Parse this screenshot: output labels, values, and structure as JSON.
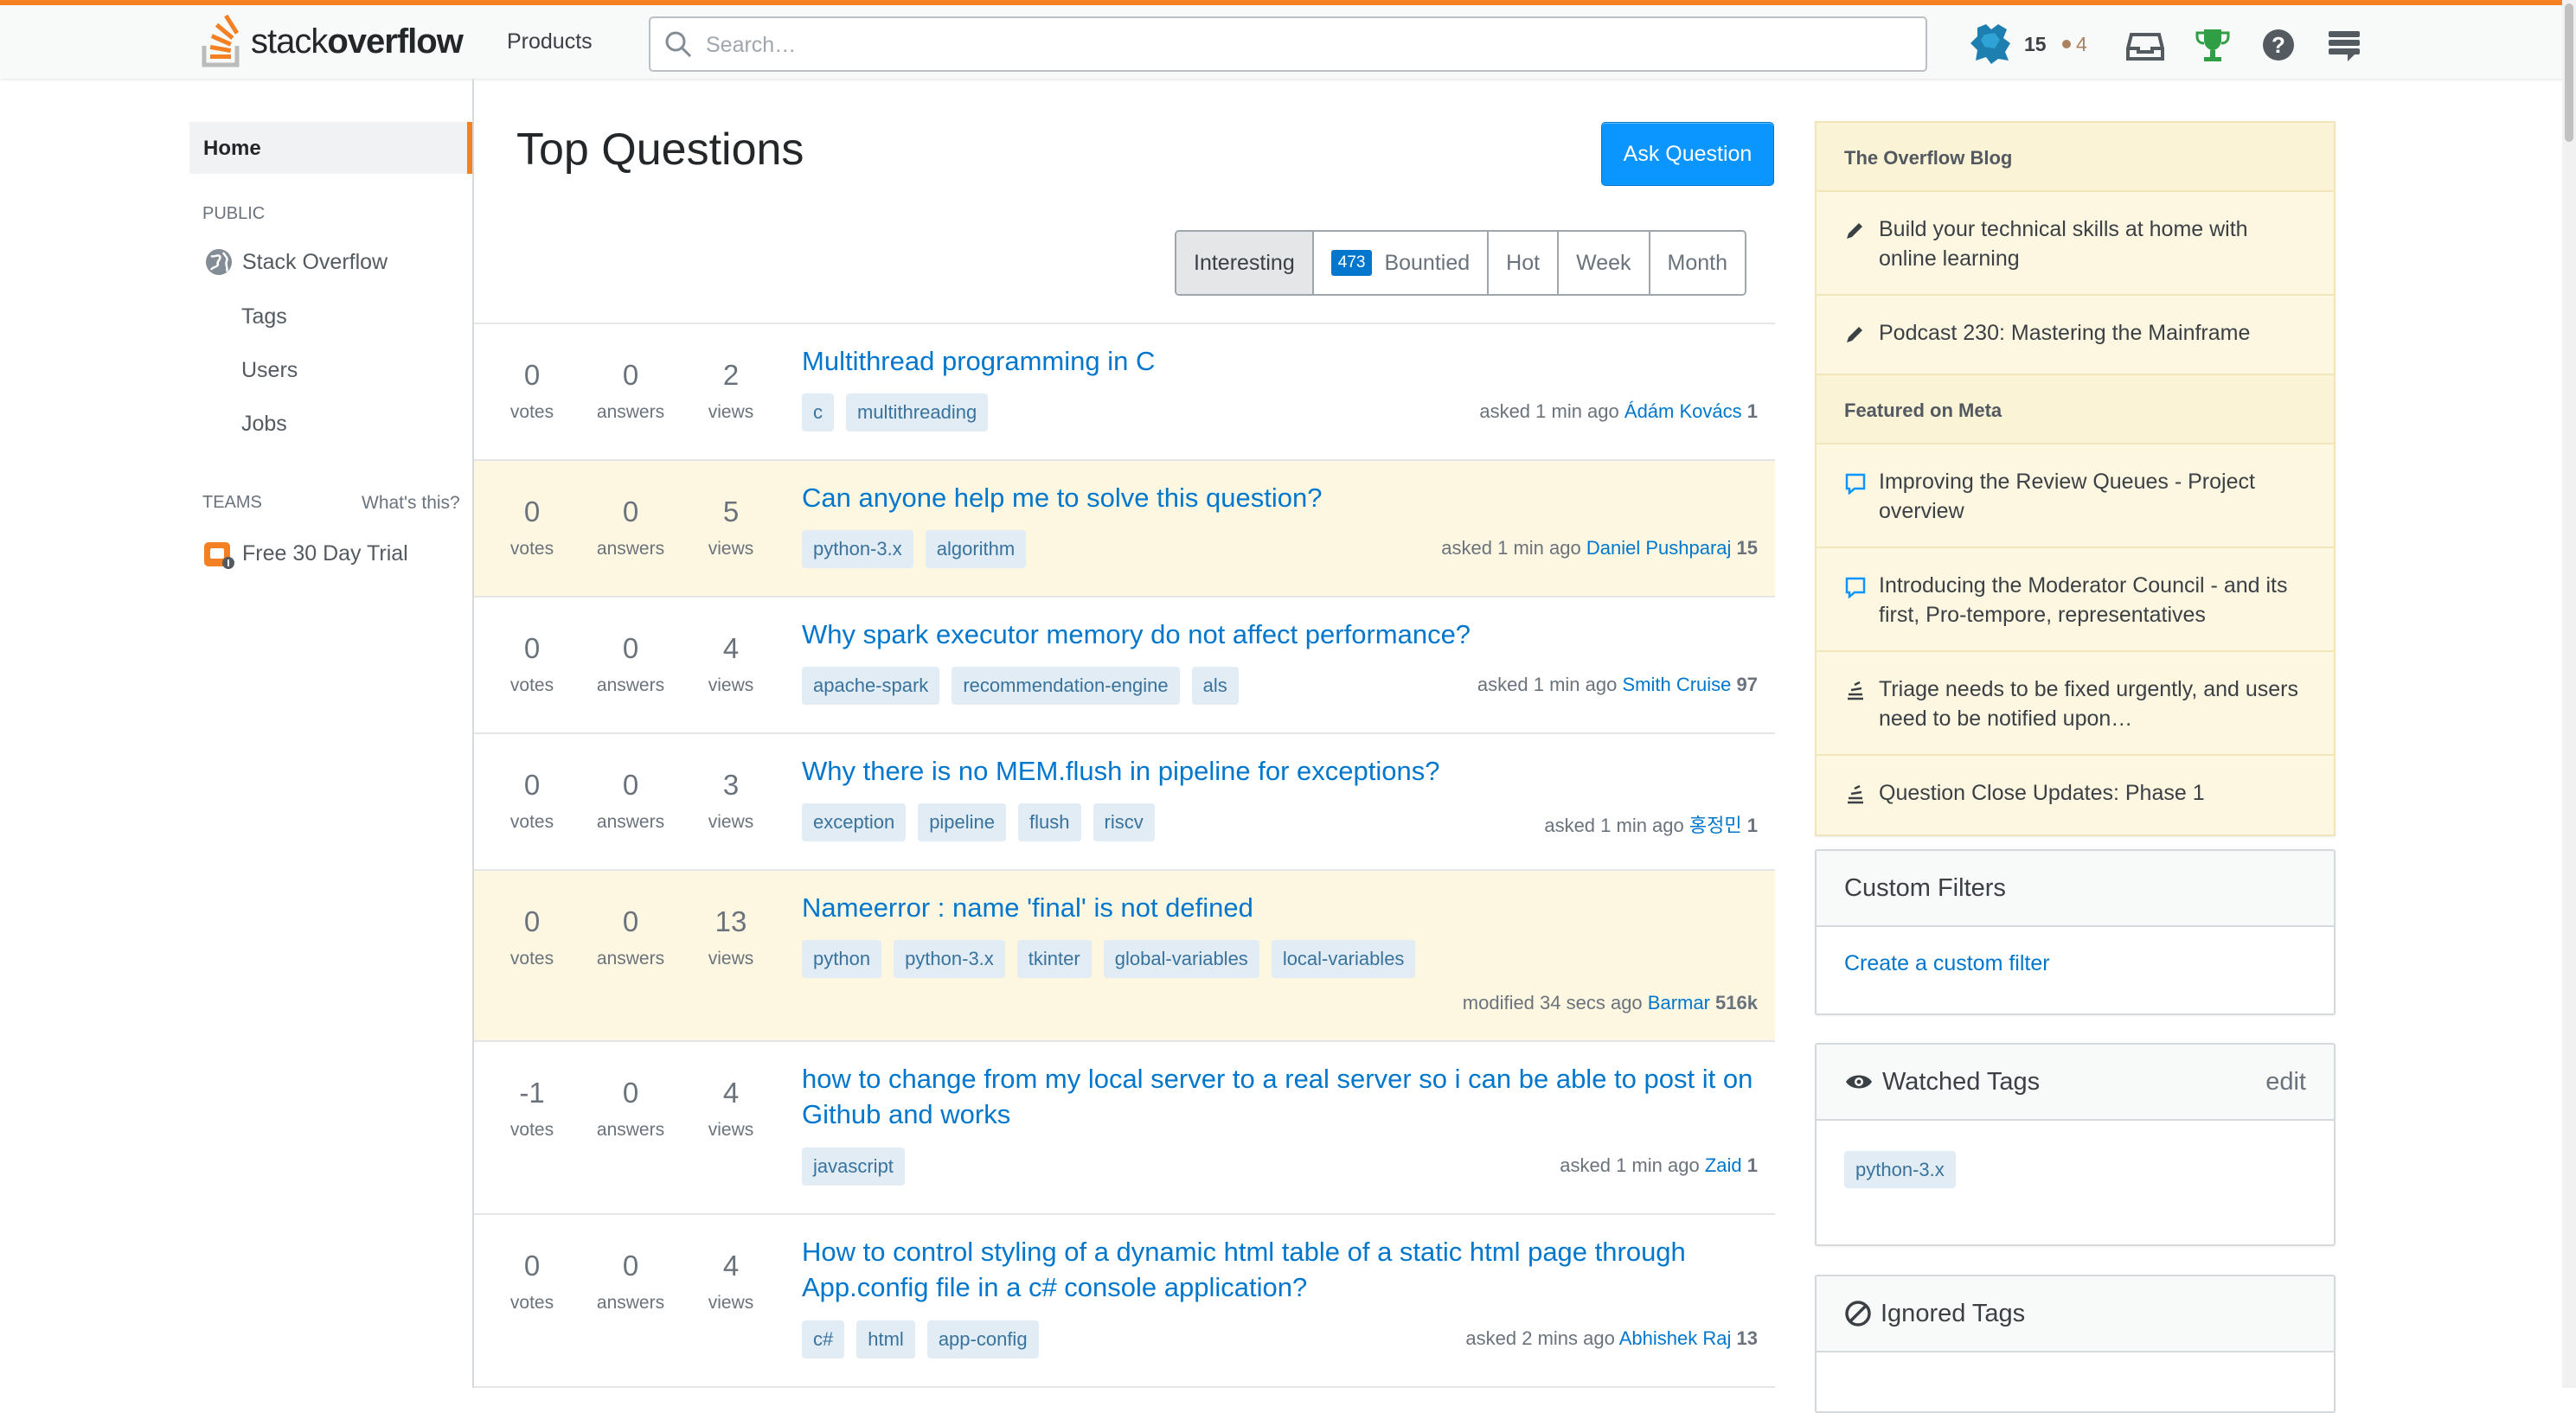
{
  "topbar": {
    "logo_text_light": "stack",
    "logo_text_bold": "overflow",
    "products_label": "Products",
    "search_placeholder": "Search…",
    "reputation": "15",
    "bronze_badges": "4",
    "icons": [
      "inbox-icon",
      "achievements-icon",
      "help-icon",
      "site-switcher-icon"
    ]
  },
  "sidebar": {
    "home_label": "Home",
    "public_heading": "PUBLIC",
    "stackoverflow_label": "Stack Overflow",
    "items": [
      "Tags",
      "Users",
      "Jobs"
    ],
    "teams_heading": "TEAMS",
    "whats_this": "What's this?",
    "trial_label": "Free 30 Day Trial"
  },
  "main": {
    "title": "Top Questions",
    "ask_button": "Ask Question",
    "filters": {
      "interesting": "Interesting",
      "bounty_count": "473",
      "bountied": "Bountied",
      "hot": "Hot",
      "week": "Week",
      "month": "Month"
    },
    "stat_labels": {
      "votes": "votes",
      "answers": "answers",
      "views": "views"
    },
    "questions": [
      {
        "votes": "0",
        "answers": "0",
        "views": "2",
        "title": "Multithread programming in C",
        "tags": [
          "c",
          "multithreading"
        ],
        "action": "asked 1 min ago",
        "user": "Ádám Kovács",
        "rep": "1"
      },
      {
        "votes": "0",
        "answers": "0",
        "views": "5",
        "title": "Can anyone help me to solve this question?",
        "tags": [
          "python-3.x",
          "algorithm"
        ],
        "action": "asked 1 min ago",
        "user": "Daniel Pushparaj",
        "rep": "15"
      },
      {
        "votes": "0",
        "answers": "0",
        "views": "4",
        "title": "Why spark executor memory do not affect performance?",
        "tags": [
          "apache-spark",
          "recommendation-engine",
          "als"
        ],
        "action": "asked 1 min ago",
        "user": "Smith Cruise",
        "rep": "97"
      },
      {
        "votes": "0",
        "answers": "0",
        "views": "3",
        "title": "Why there is no MEM.flush in pipeline for exceptions?",
        "tags": [
          "exception",
          "pipeline",
          "flush",
          "riscv"
        ],
        "action": "asked 1 min ago",
        "user": "홍정민",
        "rep": "1"
      },
      {
        "votes": "0",
        "answers": "0",
        "views": "13",
        "title": "Nameerror : name 'final' is not defined",
        "tags": [
          "python",
          "python-3.x",
          "tkinter",
          "global-variables",
          "local-variables"
        ],
        "action": "modified 34 secs ago",
        "user": "Barmar",
        "rep": "516k"
      },
      {
        "votes": "-1",
        "answers": "0",
        "views": "4",
        "title": "how to change from my local server to a real server so i can be able to post it on Github and works",
        "tags": [
          "javascript"
        ],
        "action": "asked 1 min ago",
        "user": "Zaid",
        "rep": "1"
      },
      {
        "votes": "0",
        "answers": "0",
        "views": "4",
        "title": "How to control styling of a dynamic html table of a static html page through App.config file in a c# console application?",
        "tags": [
          "c#",
          "html",
          "app-config"
        ],
        "action": "asked 2 mins ago",
        "user": "Abhishek Raj",
        "rep": "13"
      }
    ]
  },
  "right": {
    "blog_heading": "The Overflow Blog",
    "blog_items": [
      "Build your technical skills at home with online learning",
      "Podcast 230: Mastering the Mainframe"
    ],
    "meta_heading": "Featured on Meta",
    "meta_items": [
      "Improving the Review Queues - Project overview",
      "Introducing the Moderator Council - and its first, Pro-tempore, representatives",
      "Triage needs to be fixed urgently, and users need to be notified upon…",
      "Question Close Updates: Phase 1"
    ],
    "custom_filters_heading": "Custom Filters",
    "create_filter_link": "Create a custom filter",
    "watched_heading": "Watched Tags",
    "watched_edit": "edit",
    "watched_tags": [
      "python-3.x"
    ],
    "ignored_heading": "Ignored Tags"
  },
  "colors": {
    "brand_orange": "#f48024",
    "link_blue": "#0077cc",
    "featured_bg": "#fdf7e2",
    "tag_bg": "#e1ecf4"
  }
}
